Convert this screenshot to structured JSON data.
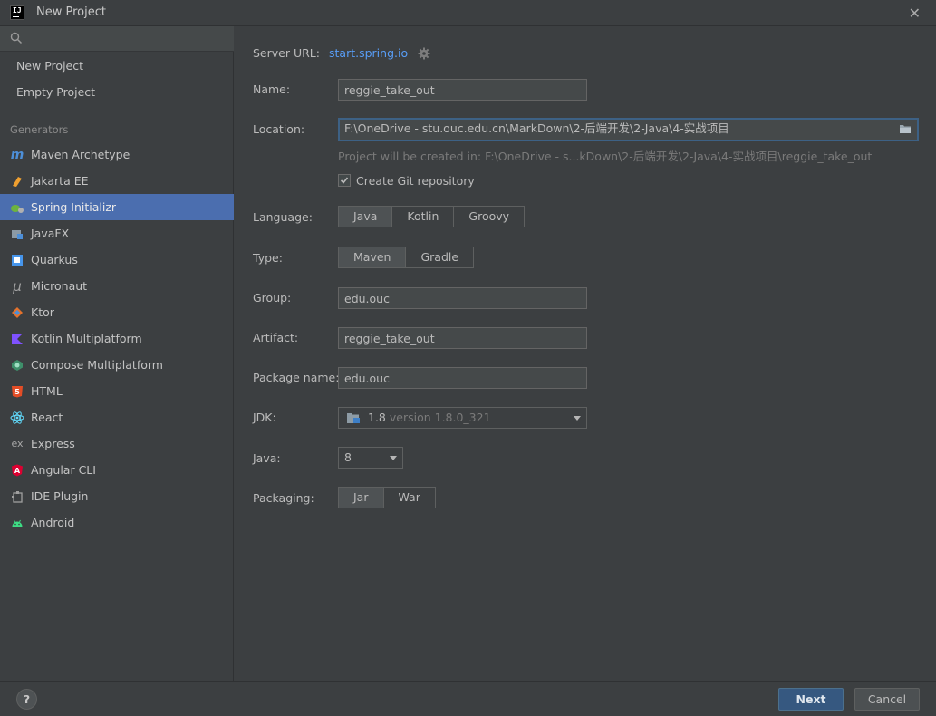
{
  "window": {
    "title": "New Project",
    "logo_text": "IJ"
  },
  "search": {
    "placeholder": ""
  },
  "sidebar": {
    "top_items": [
      {
        "label": "New Project"
      },
      {
        "label": "Empty Project"
      }
    ],
    "generators_header": "Generators",
    "generators": [
      {
        "label": "Maven Archetype",
        "icon": "maven-icon",
        "selected": false
      },
      {
        "label": "Jakarta EE",
        "icon": "jakarta-icon",
        "selected": false
      },
      {
        "label": "Spring Initializr",
        "icon": "spring-icon",
        "selected": true
      },
      {
        "label": "JavaFX",
        "icon": "javafx-icon",
        "selected": false
      },
      {
        "label": "Quarkus",
        "icon": "quarkus-icon",
        "selected": false
      },
      {
        "label": "Micronaut",
        "icon": "micronaut-icon",
        "selected": false
      },
      {
        "label": "Ktor",
        "icon": "ktor-icon",
        "selected": false
      },
      {
        "label": "Kotlin Multiplatform",
        "icon": "kotlin-icon",
        "selected": false
      },
      {
        "label": "Compose Multiplatform",
        "icon": "compose-icon",
        "selected": false
      },
      {
        "label": "HTML",
        "icon": "html5-icon",
        "selected": false
      },
      {
        "label": "React",
        "icon": "react-icon",
        "selected": false
      },
      {
        "label": "Express",
        "icon": "express-icon",
        "selected": false
      },
      {
        "label": "Angular CLI",
        "icon": "angular-icon",
        "selected": false
      },
      {
        "label": "IDE Plugin",
        "icon": "plugin-icon",
        "selected": false
      },
      {
        "label": "Android",
        "icon": "android-icon",
        "selected": false
      }
    ]
  },
  "form": {
    "server_url_label": "Server URL:",
    "server_url": "start.spring.io",
    "name_label": "Name:",
    "name": "reggie_take_out",
    "location_label": "Location:",
    "location": "F:\\OneDrive - stu.ouc.edu.cn\\MarkDown\\2-后端开发\\2-Java\\4-实战项目",
    "location_hint": "Project will be created in: F:\\OneDrive - s...kDown\\2-后端开发\\2-Java\\4-实战项目\\reggie_take_out",
    "git_label": "Create Git repository",
    "git_checked": true,
    "language_label": "Language:",
    "languages": [
      "Java",
      "Kotlin",
      "Groovy"
    ],
    "language_selected": "Java",
    "type_label": "Type:",
    "types": [
      "Maven",
      "Gradle"
    ],
    "type_selected": "Maven",
    "group_label": "Group:",
    "group": "edu.ouc",
    "artifact_label": "Artifact:",
    "artifact": "reggie_take_out",
    "package_label": "Package name:",
    "package": "edu.ouc",
    "jdk_label": "JDK:",
    "jdk_version": "1.8",
    "jdk_detail": "version 1.8.0_321",
    "java_label": "Java:",
    "java": "8",
    "packaging_label": "Packaging:",
    "packagings": [
      "Jar",
      "War"
    ],
    "packaging_selected": "Jar"
  },
  "footer": {
    "help": "?",
    "next": "Next",
    "cancel": "Cancel"
  },
  "colors": {
    "accent": "#4b6eaf",
    "link": "#589df6",
    "primary_button": "#365880",
    "background": "#3c3f41"
  }
}
